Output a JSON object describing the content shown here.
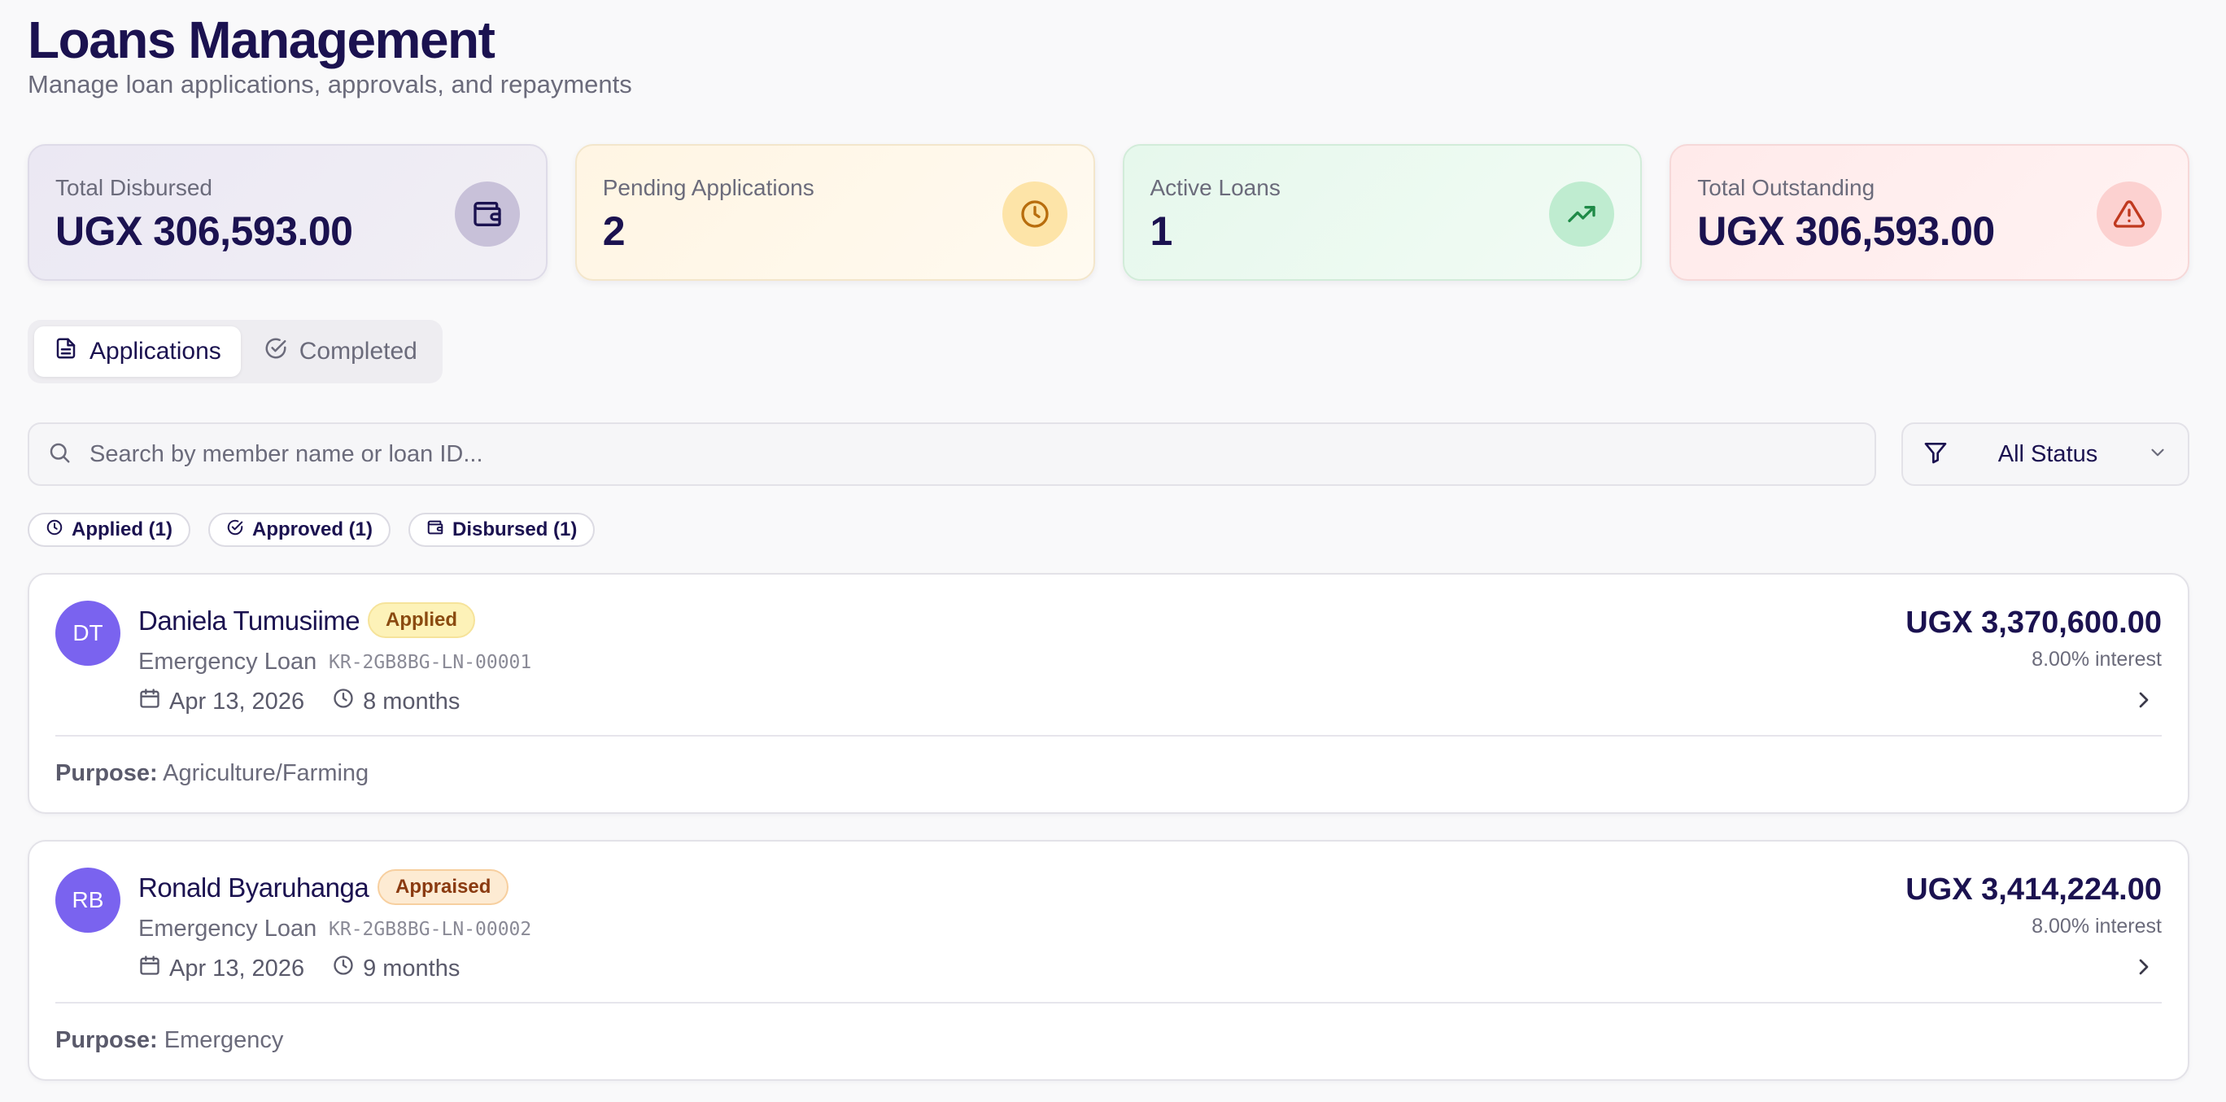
{
  "header": {
    "title": "Loans Management",
    "subtitle": "Manage loan applications, approvals, and repayments"
  },
  "stats": [
    {
      "label": "Total Disbursed",
      "value": "UGX 306,593.00",
      "icon": "wallet-icon"
    },
    {
      "label": "Pending Applications",
      "value": "2",
      "icon": "clock-icon"
    },
    {
      "label": "Active Loans",
      "value": "1",
      "icon": "trending-up-icon"
    },
    {
      "label": "Total Outstanding",
      "value": "UGX 306,593.00",
      "icon": "alert-triangle-icon"
    }
  ],
  "tabs": [
    {
      "label": "Applications",
      "active": true,
      "icon": "document-icon"
    },
    {
      "label": "Completed",
      "active": false,
      "icon": "check-circle-icon"
    }
  ],
  "search": {
    "placeholder": "Search by member name or loan ID..."
  },
  "filter": {
    "selected": "All Status"
  },
  "chips": [
    {
      "label": "Applied (1)",
      "icon": "clock-icon"
    },
    {
      "label": "Approved (1)",
      "icon": "check-circle-icon"
    },
    {
      "label": "Disbursed (1)",
      "icon": "wallet-icon"
    }
  ],
  "loans": [
    {
      "initials": "DT",
      "name": "Daniela Tumusiime",
      "status": "Applied",
      "type": "Emergency Loan",
      "id": "KR-2GB8BG-LN-00001",
      "date": "Apr 13, 2026",
      "term": "8 months",
      "amount": "UGX 3,370,600.00",
      "interest": "8.00% interest",
      "purpose_label": "Purpose:",
      "purpose": "Agriculture/Farming"
    },
    {
      "initials": "RB",
      "name": "Ronald Byaruhanga",
      "status": "Appraised",
      "type": "Emergency Loan",
      "id": "KR-2GB8BG-LN-00002",
      "date": "Apr 13, 2026",
      "term": "9 months",
      "amount": "UGX 3,414,224.00",
      "interest": "8.00% interest",
      "purpose_label": "Purpose:",
      "purpose": "Emergency"
    }
  ],
  "colors": {
    "heading": "#1b1250",
    "avatar": "#7a63ef",
    "applied_badge": "#fdf2b8",
    "appraised_badge": "#fdebd3"
  }
}
